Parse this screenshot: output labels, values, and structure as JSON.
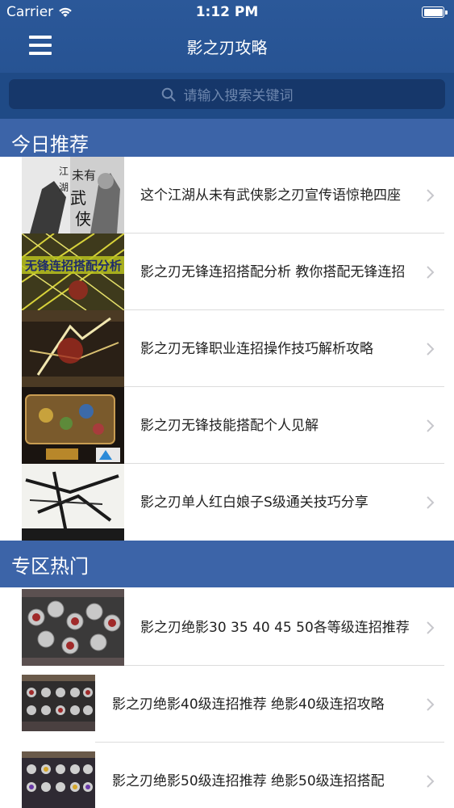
{
  "status": {
    "carrier": "Carrier",
    "time": "1:12 PM"
  },
  "nav": {
    "title": "影之刃攻略"
  },
  "search": {
    "placeholder": "请输入搜索关键词"
  },
  "sections": [
    {
      "title": "今日推荐",
      "items": [
        {
          "title": "这个江湖从未有武侠影之刃宣传语惊艳四座"
        },
        {
          "title": "影之刃无锋连招搭配分析 教你搭配无锋连招"
        },
        {
          "title": "影之刃无锋职业连招操作技巧解析攻略"
        },
        {
          "title": "影之刃无锋技能搭配个人见解"
        },
        {
          "title": "影之刃单人红白娘子S级通关技巧分享"
        }
      ]
    },
    {
      "title": "专区热门",
      "items": [
        {
          "title": "影之刃绝影30 35 40 45 50各等级连招推荐"
        },
        {
          "title": "影之刃绝影40级连招推荐 绝影40级连招攻略"
        },
        {
          "title": "影之刃绝影50级连招推荐 绝影50级连招搭配"
        }
      ]
    }
  ],
  "thumb_text": {
    "t1": "江湖未有武侠",
    "t2": "无锋连招搭配分析"
  },
  "colors": {
    "nav": "#2b5899",
    "section": "#3c64a8",
    "search_bg": "#16376a"
  }
}
